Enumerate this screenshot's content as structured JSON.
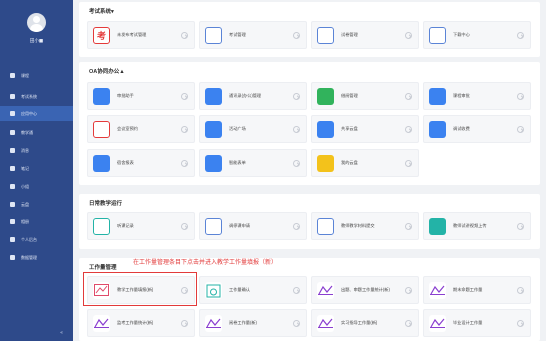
{
  "sidebar": {
    "user_name": "田小■",
    "items": [
      {
        "label": "课程",
        "active": false
      },
      {
        "label": "考试系统",
        "active": false
      },
      {
        "label": "应用中心",
        "active": true
      },
      {
        "label": "教学通",
        "active": false
      },
      {
        "label": "消息",
        "active": false
      },
      {
        "label": "笔记",
        "active": false
      },
      {
        "label": "小组",
        "active": false
      },
      {
        "label": "云盘",
        "active": false
      },
      {
        "label": "相册",
        "active": false
      },
      {
        "label": "个人后台",
        "active": false
      },
      {
        "label": "数据管理",
        "active": false
      }
    ],
    "collapse_label": "«"
  },
  "sections": {
    "exam": {
      "title": "考试系统▾",
      "tiles": [
        "未发布考试管理",
        "考试管理",
        "试卷管理",
        "下载中心"
      ]
    },
    "oa": {
      "title": "OA协同办公▲",
      "tiles": [
        "审批助手",
        "通讯录(办公)管理",
        "借阅管理",
        "课程审批",
        "会议室预约",
        "活动广场",
        "共享云盘",
        "调试收费",
        "宿舍报表",
        "智能表单",
        "我的云盘"
      ]
    },
    "teaching": {
      "title": "日常教学运行",
      "tiles": [
        "听课记录",
        "调停课申请",
        "教师教学材料提交",
        "教师试讲视频上传"
      ]
    },
    "workload": {
      "title": "工作量管理",
      "tiles": [
        "教学工作量填报(新)",
        "工作量确认",
        "出题、审题工作量统计(新)",
        "期末命题工作量",
        "监考工作量统计(新)",
        "阅卷工作量(新)",
        "实习指导工作量(新)",
        "毕业设计工作量"
      ]
    }
  },
  "annotation": "在工作量管理条目下点击并进入教学工作量填报（新）",
  "colors": {
    "sidebar": "#2e4a8a",
    "active": "#3a64b3",
    "highlight": "#e23a3a"
  }
}
